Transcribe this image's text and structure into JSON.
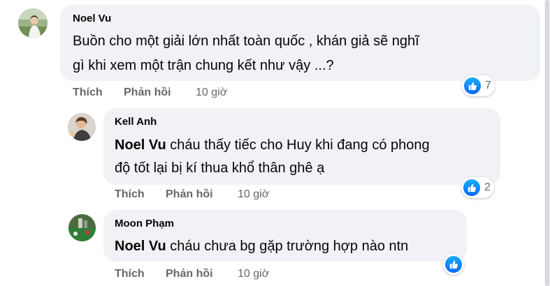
{
  "comments": [
    {
      "author": "Noel Vu",
      "mention": "",
      "line1": "Buồn cho một giải lớn nhất toàn quốc , khán giả sẽ nghĩ",
      "line2": "gì khi xem một trận chung kết như vậy ...?",
      "like_label": "Thích",
      "reply_label": "Phản hồi",
      "time": "10 giờ",
      "reaction_icon": "like-icon",
      "reaction_count": "7"
    },
    {
      "author": "Kell Anh",
      "mention": "Noel Vu",
      "line1": "cháu thấy tiếc cho Huy khi đang có phong",
      "line2": "độ tốt lại bị kí thua khổ thân ghê ạ",
      "like_label": "Thích",
      "reply_label": "Phản hồi",
      "time": "10 giờ",
      "reaction_icon": "like-icon",
      "reaction_count": "2"
    },
    {
      "author": "Moon Phạm",
      "mention": "Noel Vu",
      "line1": "cháu chưa bg gặp trường hợp nào ntn",
      "like_label": "Thích",
      "reply_label": "Phản hồi",
      "time": "10 giờ",
      "reaction_icon": "like-icon",
      "reaction_count": ""
    }
  ],
  "colors": {
    "bubble": "#f0f2f5",
    "secondary_text": "#65676b",
    "like_blue": "#0866ff"
  }
}
